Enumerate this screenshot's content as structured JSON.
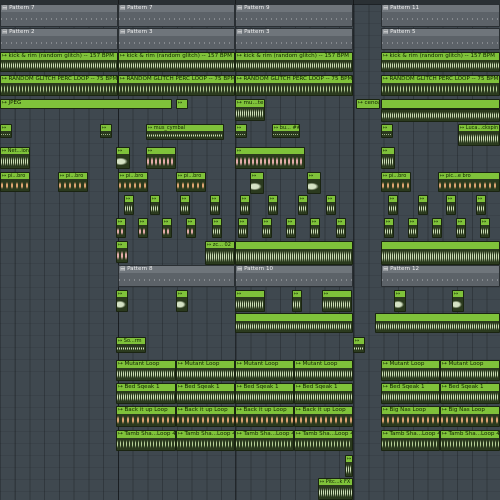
{
  "app": {
    "view": "Playlist"
  },
  "patterns": [
    {
      "id": "p7a",
      "label": "Pattern 7"
    },
    {
      "id": "p7b",
      "label": "Pattern 7"
    },
    {
      "id": "p9",
      "label": "Pattern 9"
    },
    {
      "id": "p11",
      "label": "Pattern 11"
    },
    {
      "id": "p2",
      "label": "Pattern 2"
    },
    {
      "id": "p3a",
      "label": "Pattern 3"
    },
    {
      "id": "p3b",
      "label": "Pattern 3"
    },
    {
      "id": "p5",
      "label": "Pattern 5"
    },
    {
      "id": "p8",
      "label": "Pattern 8"
    },
    {
      "id": "p10",
      "label": "Pattern 10"
    },
    {
      "id": "p12",
      "label": "Pattern 12"
    }
  ],
  "audio": {
    "kick1": "kick & rim (random glitch) -- 157 BPM",
    "kick2": "kick & rim (random glitch) -- 157 BPM",
    "kick3": "kick & rim (random glitch) -- 157 BPM",
    "kick4": "kick & rim (random glitch) -- 157 BPM",
    "glitch1": "RANDOM GLITCH PERC LOOP -- 75 BPM",
    "glitch2": "RANDOM GLITCH PERC LOOP -- 75 BPM",
    "glitch3": "RANDOM GLITCH PERC LOOP -- 75 BPM",
    "glitch4": "RANDOM GLITCH PERC LOOP -- 75 BPM",
    "jpeg": "JPEG",
    "mute": "mu...te",
    "cenoa": "cenoa",
    "muscymbal": "mus_cymbal",
    "bu": "bu... ##",
    "luca": "Luca...ckspin",
    "net": "Net...ion",
    "pibro1": "pi...bro",
    "pibro2": "pi...bro",
    "pibro3": "pi...bro",
    "pibro4": "pi...bro",
    "pibro5": "pi...bro",
    "picebro": "pic...e bro",
    "zc": "zc... 02",
    "so": "So...rm",
    "mutant1": "Mutant Loop",
    "mutant2": "Mutant Loop",
    "mutant3": "Mutant Loop",
    "mutant4": "Mutant Loop",
    "mutant5": "Mutant Loop",
    "mutant6": "Mutant Loop",
    "mutant7": "Mutant Loop",
    "bed1": "Bed Sqeak 1",
    "bed2": "Bed Sqeak 1",
    "bed3": "Bed Sqeak 1",
    "bed4": "Bed Sqeak 1",
    "bed5": "Bed Sqeak 1",
    "bed6": "Bed Sqeak 1",
    "bed7": "Bed Sqeak 1",
    "back1": "Back it up Loop",
    "back2": "Back it up Loop",
    "back3": "Back it up Loop",
    "back4": "Back it up Loop",
    "back5": "Back it up Loop",
    "bignas1": "Big Nas Loop",
    "bignas2": "Big Nas Loop",
    "tamb1": "Tamb Sha...Loop 4",
    "tamb2": "Tamb Sha...Loop 4",
    "tamb3": "Tamb Sha...Loop 4",
    "tamb4": "Tamb Sha...Loop 4",
    "tamb5": "Tamb Sha...Loop 4",
    "tamb6": "Tamb Sha...Loop 4",
    "tamb7": "Tamb Sha...Loop 4",
    "pitc": "Pitc...k FX"
  },
  "colors": {
    "background": "#3f484f",
    "pattern_clip": "#6f757b",
    "audio_clip_header": "#7fc23a",
    "waveform": "#dff0c8",
    "drum_pink": "#f6b8b8",
    "drum_orange": "#f2b07a"
  }
}
